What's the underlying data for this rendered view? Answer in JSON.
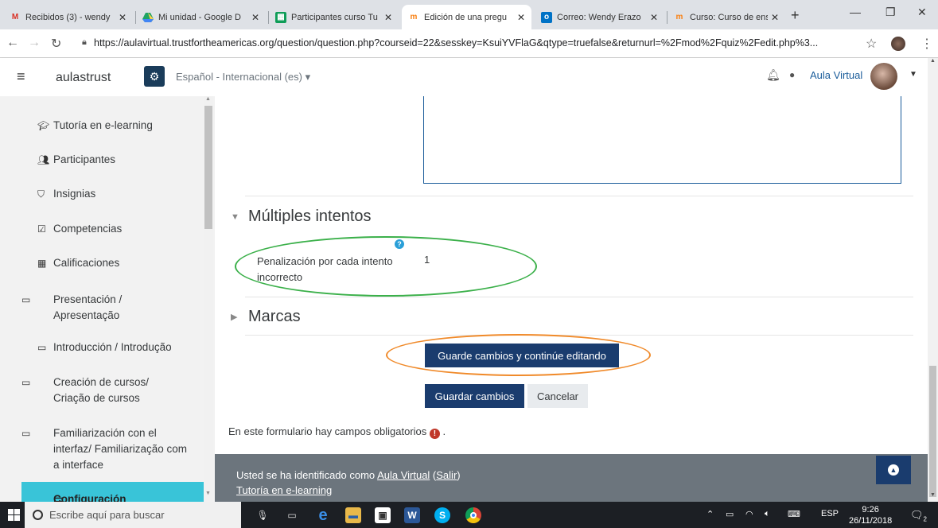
{
  "browser": {
    "tabs": [
      {
        "title": "Recibidos (3) - wendy",
        "icon": "gmail-icon",
        "active": false
      },
      {
        "title": "Mi unidad - Google D",
        "icon": "drive-icon",
        "active": false
      },
      {
        "title": "Participantes curso Tu",
        "icon": "sheets-icon",
        "active": false
      },
      {
        "title": "Edición de una pregu",
        "icon": "moodle-icon",
        "active": true
      },
      {
        "title": "Correo: Wendy Erazo",
        "icon": "outlook-icon",
        "active": false
      },
      {
        "title": "Curso: Curso de ense",
        "icon": "moodle-icon",
        "active": false
      }
    ],
    "url": "https://aulavirtual.trustfortheamericas.org/question/question.php?courseid=22&sesskey=KsuiYVFlaG&qtype=truefalse&returnurl=%2Fmod%2Fquiz%2Fedit.php%3..."
  },
  "navbar": {
    "site_name": "aulastrust",
    "language": "Español - Internacional (es) ▾",
    "user_name": "Aula Virtual"
  },
  "drawer": {
    "items": [
      {
        "label": "Tutoría en e-learning",
        "icon": "graduation-cap-icon"
      },
      {
        "label": "Participantes",
        "icon": "users-icon"
      },
      {
        "label": "Insignias",
        "icon": "shield-icon"
      },
      {
        "label": "Competencias",
        "icon": "checkbox-icon"
      },
      {
        "label": "Calificaciones",
        "icon": "table-icon"
      },
      {
        "label": "Presentación / Apresentação",
        "icon": "folder-icon"
      },
      {
        "label": "Introducción / Introdução",
        "icon": "folder-icon"
      },
      {
        "label": "Creación de cursos/ Criação de cursos",
        "icon": "folder-icon"
      },
      {
        "label": "Familiarización con el interfaz/ Familiarização com a interface",
        "icon": "folder-icon"
      },
      {
        "label": "Configuración",
        "icon": "folder-icon"
      }
    ]
  },
  "main": {
    "section_multiple": "Múltiples intentos",
    "penalty_label": "Penalización por cada intento incorrecto",
    "penalty_value": "1",
    "section_tags": "Marcas",
    "btn_save_continue": "Guarde cambios y continúe editando",
    "btn_save": "Guardar cambios",
    "btn_cancel": "Cancelar",
    "required_note": "En este formulario hay campos obligatorios",
    "required_dot": "."
  },
  "footer": {
    "logged_prefix": "Usted se ha identificado como",
    "user_link": "Aula Virtual",
    "logout": "Salir",
    "course_link": "Tutoría en e-learning"
  },
  "taskbar": {
    "search_placeholder": "Escribe aquí para buscar",
    "language": "ESP",
    "time": "9:26",
    "date": "26/11/2018",
    "notifications": "2"
  }
}
